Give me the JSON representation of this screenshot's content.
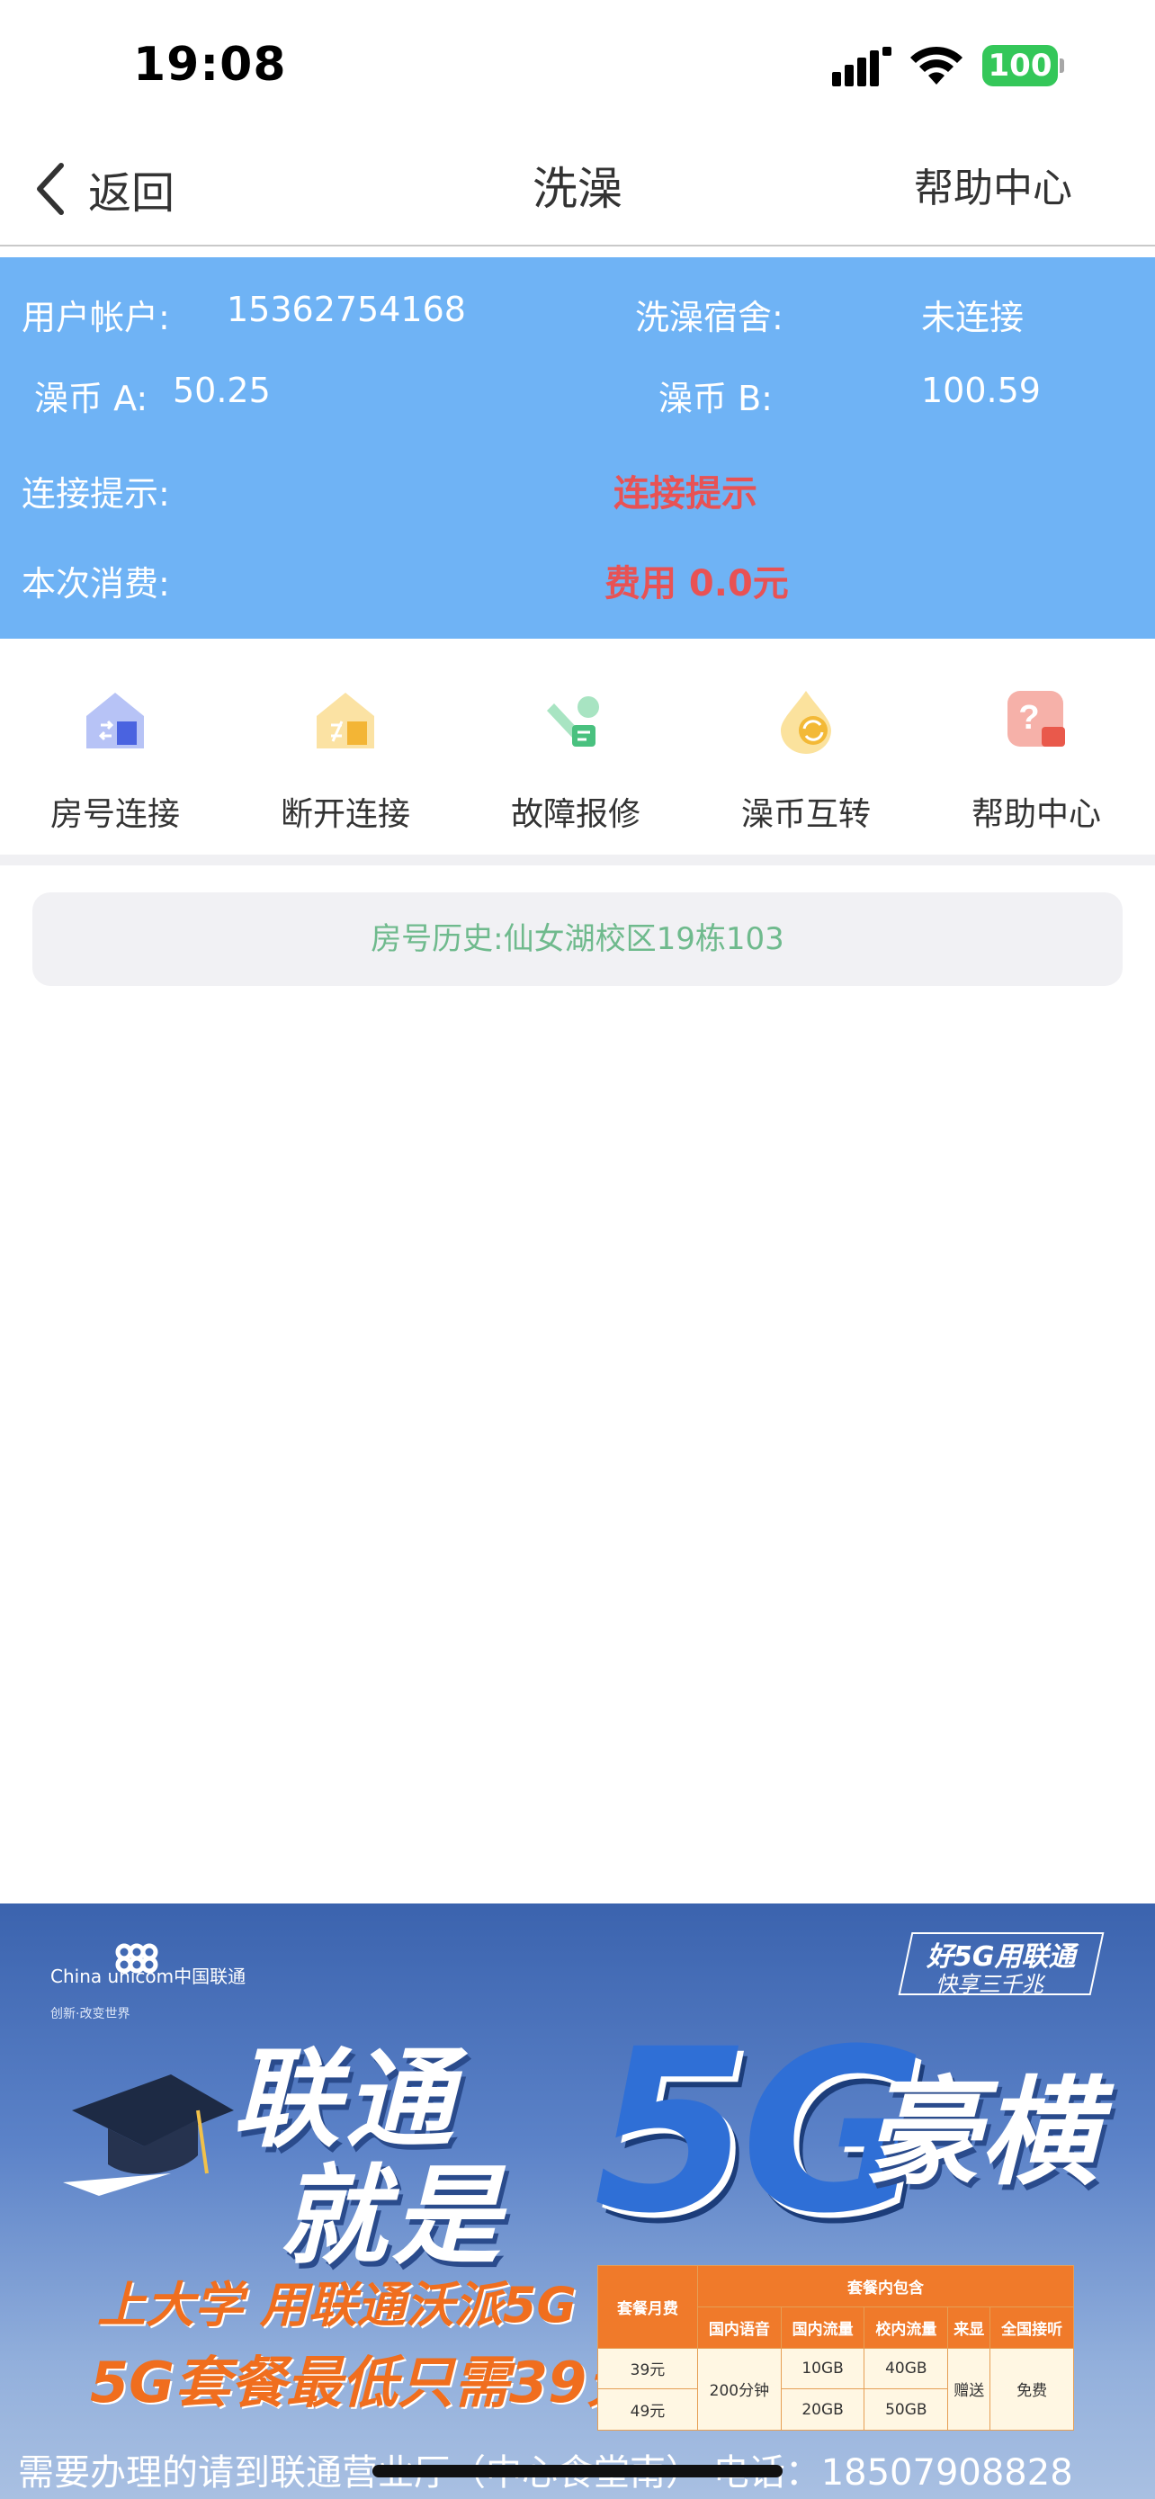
{
  "status_bar": {
    "time": "19:08",
    "battery": "100"
  },
  "nav": {
    "back_label": "返回",
    "title": "洗澡",
    "help_label": "帮助中心"
  },
  "info": {
    "account_label": "用户帐户:",
    "account_value": "15362754168",
    "dorm_label": "洗澡宿舍:",
    "dorm_value": "未连接",
    "coin_a_label": "澡币 A:",
    "coin_a_value": "50.25",
    "coin_b_label": "澡币 B:",
    "coin_b_value": "100.59",
    "hint_label": "连接提示:",
    "hint_value": "连接提示",
    "cost_label": "本次消费:",
    "cost_value": "费用 0.0元"
  },
  "functions": [
    {
      "label": "房号连接",
      "icon": "house-connect-icon",
      "color": "#5b74e8"
    },
    {
      "label": "断开连接",
      "icon": "house-disconnect-icon",
      "color": "#f5b83d"
    },
    {
      "label": "故障报修",
      "icon": "wrench-icon",
      "color": "#5cc98a"
    },
    {
      "label": "澡币互转",
      "icon": "coin-transfer-icon",
      "color": "#f2be3a"
    },
    {
      "label": "帮助中心",
      "icon": "help-icon",
      "color": "#ee6b60"
    }
  ],
  "history": {
    "text": "房号历史:仙女湖校区19栋103"
  },
  "banner": {
    "logo_text": "China unicom中国联通",
    "logo_sub": "创新·改变世界",
    "slogan1": "好5G用联通",
    "slogan2": "快享三千兆",
    "headline1": "联通",
    "headline2": "就是",
    "headline_5g": "5G",
    "headline3": "豪横",
    "line1": "上大学 用联通沃派5G",
    "line2": "5G套餐最低只需39元",
    "table": {
      "col_fee": "套餐月费",
      "col_included": "套餐内包含",
      "col_voice": "国内语音",
      "col_data": "国内流量",
      "col_campus": "校内流量",
      "col_caller": "来显",
      "col_national": "全国接听",
      "price1": "39元",
      "price2": "49元",
      "voice": "200分钟",
      "data1": "10GB",
      "data2": "20GB",
      "campus1": "40GB",
      "campus2": "50GB",
      "caller": "赠送",
      "national": "免费"
    },
    "bottom": "需要办理的请到联通营业厅（中心食堂南）  电话：18507908828"
  }
}
